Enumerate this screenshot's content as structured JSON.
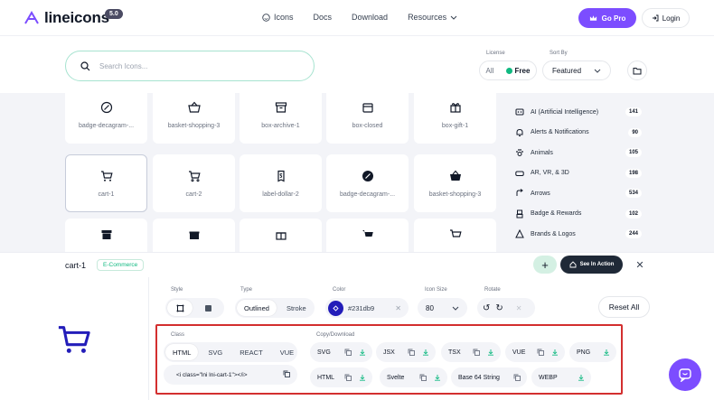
{
  "header": {
    "logo_text": "lineicons",
    "logo_version": "5.0",
    "nav": [
      {
        "label": "Icons",
        "icon": "smiley-icon"
      },
      {
        "label": "Docs"
      },
      {
        "label": "Download"
      },
      {
        "label": "Resources",
        "icon": "chevron-down-icon"
      }
    ],
    "go_pro_label": "Go Pro",
    "login_label": "Login"
  },
  "search": {
    "placeholder": "Search Icons...",
    "license_label": "License",
    "license_all": "All",
    "license_free": "Free",
    "sort_label": "Sort By",
    "sort_value": "Featured"
  },
  "gallery": {
    "row1": [
      "badge-decagram-...",
      "basket-shopping-3",
      "box-archive-1",
      "box-closed",
      "box-gift-1"
    ],
    "row2": [
      "cart-1",
      "cart-2",
      "label-dollar-2",
      "badge-decagram-...",
      "basket-shopping-3"
    ],
    "row3_icons": [
      "archive-icon",
      "gift-icon",
      "gift-icon",
      "cart-icon",
      "cart-icon"
    ]
  },
  "categories": [
    {
      "label": "AI (Artificial Intelligence)",
      "count": "141",
      "icon": "ai-icon"
    },
    {
      "label": "Alerts & Notifications",
      "count": "90",
      "icon": "bell-icon"
    },
    {
      "label": "Animals",
      "count": "105",
      "icon": "paw-icon"
    },
    {
      "label": "AR, VR, & 3D",
      "count": "198",
      "icon": "vr-icon"
    },
    {
      "label": "Arrows",
      "count": "534",
      "icon": "arrow-icon"
    },
    {
      "label": "Badge & Rewards",
      "count": "102",
      "icon": "badge-icon"
    },
    {
      "label": "Brands & Logos",
      "count": "244",
      "icon": "brand-icon"
    }
  ],
  "detail": {
    "icon_name": "cart-1",
    "category_tag": "E-Commerce",
    "see_action": "See In Action",
    "style_label": "Style",
    "type_label": "Type",
    "type_outlined": "Outlined",
    "type_stroke": "Stroke",
    "color_label": "Color",
    "color_value": "#231db9",
    "icon_size_label": "Icon Size",
    "icon_size_value": "80",
    "rotate_label": "Rotate",
    "reset_label": "Reset All",
    "class_label": "Class",
    "class_tabs": [
      "HTML",
      "SVG",
      "REACT",
      "VUE"
    ],
    "class_code": "<i class=\"lni lni-cart-1\"></i>",
    "copy_download_label": "Copy/Download",
    "downloads_row1": [
      "SVG",
      "JSX",
      "TSX",
      "VUE",
      "PNG"
    ],
    "downloads_row2": [
      "HTML",
      "Svelte",
      "Base 64 String",
      "WEBP"
    ],
    "accent_color": "#231db9"
  }
}
